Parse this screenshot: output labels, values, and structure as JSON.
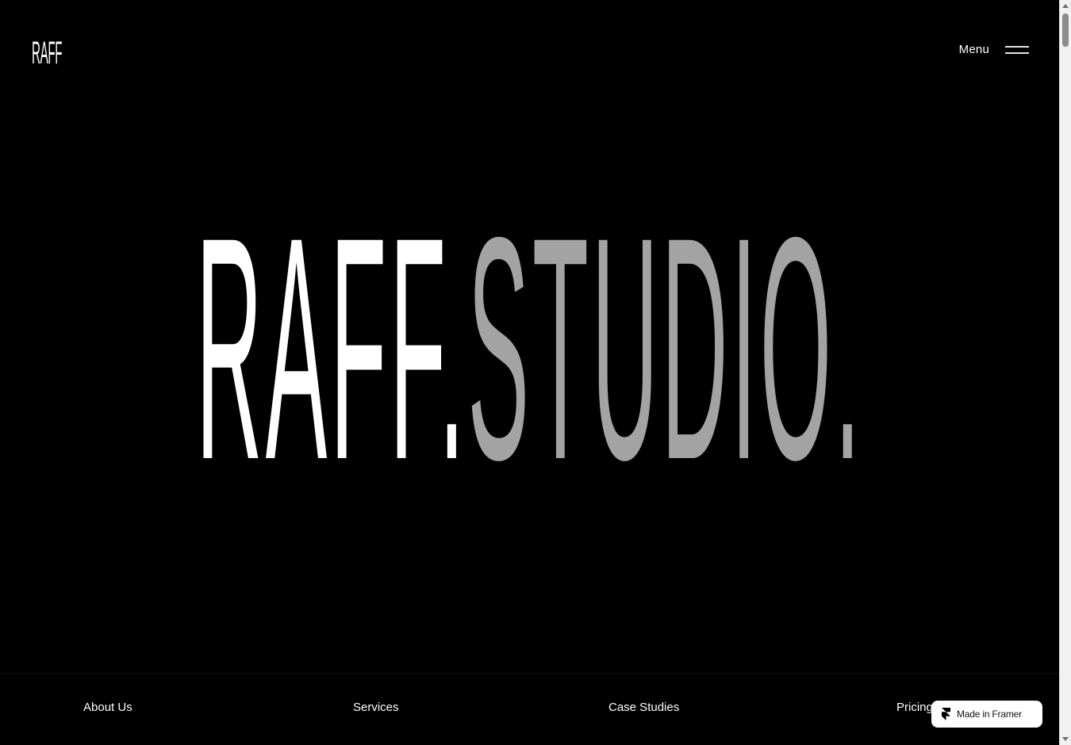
{
  "header": {
    "logo_text": "RAFF",
    "menu_label": "Menu",
    "menu_icon": "hamburger-icon"
  },
  "hero": {
    "title_part1": "RAFF.",
    "title_part2": "STUDIO."
  },
  "footer_nav": {
    "items": [
      {
        "label": "About Us"
      },
      {
        "label": "Services"
      },
      {
        "label": "Case Studies"
      },
      {
        "label": "Pricing"
      }
    ]
  },
  "badge": {
    "label": "Made in Framer",
    "icon": "framer-icon"
  },
  "colors": {
    "background": "#000000",
    "primary_text": "#ffffff",
    "accent_gray": "#a3a3a3"
  }
}
